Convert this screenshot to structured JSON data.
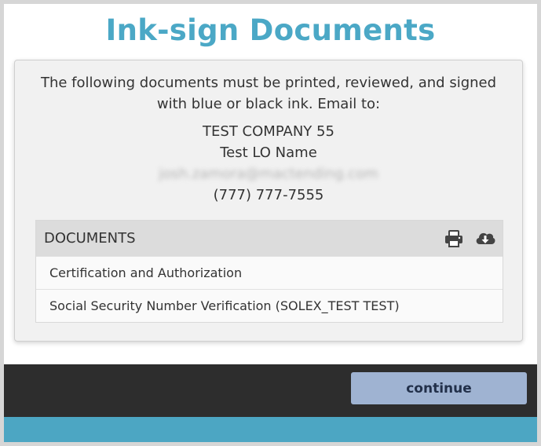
{
  "page": {
    "title": "Ink-sign Documents"
  },
  "intro": {
    "text": "The following documents must be printed, reviewed, and signed with blue or black ink. Email to:"
  },
  "contact": {
    "company": "TEST COMPANY 55",
    "name": "Test LO Name",
    "email": "josh.zamora@mactending.com",
    "phone": "(777) 777-7555"
  },
  "documents": {
    "header": "DOCUMENTS",
    "icons": {
      "print": "print-icon",
      "download": "cloud-download-icon"
    },
    "items": [
      {
        "label": "Certification and Authorization"
      },
      {
        "label": "Social Security Number Verification (SOLEX_TEST TEST)"
      }
    ]
  },
  "footer": {
    "continue_label": "continue"
  },
  "colors": {
    "title": "#4ba8c6",
    "footer_bg": "#2d2d2d",
    "button_bg": "#9fb3d2",
    "bottom_bar": "#4ca6c3"
  }
}
